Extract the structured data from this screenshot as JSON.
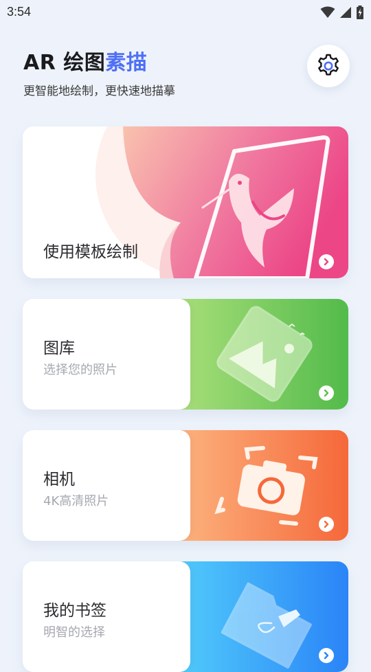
{
  "status_bar": {
    "time": "3:54"
  },
  "header": {
    "title_prefix": "AR 绘图",
    "title_accent": "素描",
    "subtitle": "更智能地绘制，更快速地描摹"
  },
  "cards": [
    {
      "label": "使用模板绘制",
      "sub": ""
    },
    {
      "label": "图库",
      "sub": "选择您的照片"
    },
    {
      "label": "相机",
      "sub": "4K高清照片"
    },
    {
      "label": "我的书签",
      "sub": "明智的选择"
    }
  ],
  "icons": {
    "settings": "gear-icon",
    "wifi": "wifi-icon",
    "signal": "signal-icon",
    "battery": "battery-icon",
    "arrow": "chevron-right-icon"
  },
  "colors": {
    "accent": "#4f6ff5",
    "template": "#ee4e8a",
    "gallery": "#5cbf4b",
    "camera": "#f66d36",
    "bookmark": "#2a84f7"
  }
}
